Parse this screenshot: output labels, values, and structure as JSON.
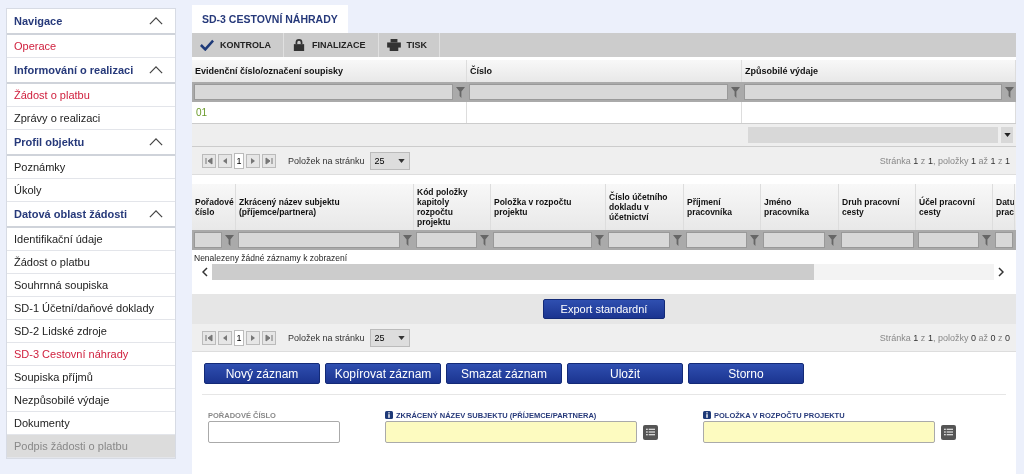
{
  "sidebar": {
    "sections": [
      {
        "title": "Navigace",
        "expanded": true,
        "items": [
          {
            "label": "Operace",
            "selected": true,
            "disabled": false
          }
        ]
      },
      {
        "title": "Informování o realizaci",
        "expanded": true,
        "items": [
          {
            "label": "Žádost o platbu",
            "selected": true,
            "disabled": false
          },
          {
            "label": "Zprávy o realizaci",
            "selected": false,
            "disabled": false
          }
        ]
      },
      {
        "title": "Profil objektu",
        "expanded": true,
        "items": [
          {
            "label": "Poznámky",
            "selected": false,
            "disabled": false
          },
          {
            "label": "Úkoly",
            "selected": false,
            "disabled": false
          }
        ]
      },
      {
        "title": "Datová oblast žádosti",
        "expanded": true,
        "items": [
          {
            "label": "Identifikační údaje",
            "selected": false,
            "disabled": false
          },
          {
            "label": "Žádost o platbu",
            "selected": false,
            "disabled": false
          },
          {
            "label": "Souhrnná soupiska",
            "selected": false,
            "disabled": false
          },
          {
            "label": "SD-1 Účetní/daňové doklady",
            "selected": false,
            "disabled": false
          },
          {
            "label": "SD-2 Lidské zdroje",
            "selected": false,
            "disabled": false
          },
          {
            "label": "SD-3 Cestovní náhrady",
            "selected": true,
            "disabled": false
          },
          {
            "label": "Soupiska příjmů",
            "selected": false,
            "disabled": false
          },
          {
            "label": "Nezpůsobilé výdaje",
            "selected": false,
            "disabled": false
          },
          {
            "label": "Dokumenty",
            "selected": false,
            "disabled": false
          },
          {
            "label": "Podpis žádosti o platbu",
            "selected": false,
            "disabled": true
          }
        ]
      }
    ]
  },
  "tabs": [
    {
      "label": "SD-3 CESTOVNÍ NÁHRADY",
      "selected": true
    }
  ],
  "toolbar": [
    {
      "label": "KONTROLA",
      "kind": "check"
    },
    {
      "label": "FINALIZACE",
      "kind": "lock"
    },
    {
      "label": "TISK",
      "kind": "print"
    }
  ],
  "summary_table": {
    "columns": [
      {
        "label": "Evidenční číslo/označení soupisky",
        "filter": true
      },
      {
        "label": "Číslo",
        "filter": true
      },
      {
        "label": "Způsobilé výdaje",
        "filter": true
      }
    ],
    "rows": [
      [
        "01",
        "",
        ""
      ]
    ],
    "pager": {
      "page": "1",
      "per_page_label": "Položek na stránku",
      "per_page": "25",
      "status": "Stránka **1** z **1**, položky **1** až **1** z **1**"
    }
  },
  "detail_table": {
    "columns": [
      {
        "label": "Pořadové číslo",
        "filter": true
      },
      {
        "label": "Zkrácený název subjektu (příjemce/partnera)",
        "filter": true
      },
      {
        "label": "Kód položky kapitoly rozpočtu projektu",
        "filter": true
      },
      {
        "label": "Položka v rozpočtu projektu",
        "filter": true
      },
      {
        "label": "Číslo účetního dokladu v účetnictví",
        "filter": true
      },
      {
        "label": "Příjmení pracovníka",
        "filter": true
      },
      {
        "label": "Jméno pracovníka",
        "filter": true
      },
      {
        "label": "Druh pracovní cesty",
        "filter": false
      },
      {
        "label": "Účel pracovní cesty",
        "filter": true
      },
      {
        "label": "Datu prac",
        "filter": false
      }
    ],
    "empty_message": "Nenalezeny žádné záznamy k zobrazení",
    "export_button": "Export standardní",
    "pager": {
      "page": "1",
      "per_page_label": "Položek na stránku",
      "per_page": "25",
      "status": "Stránka **1** z **1**, položky **0** až **0** z **0**"
    }
  },
  "actions": [
    "Nový záznam",
    "Kopírovat záznam",
    "Smazat záznam",
    "Uložit",
    "Storno"
  ],
  "form": {
    "fields": [
      {
        "label": "POŘADOVÉ ČÍSLO",
        "required": false
      },
      {
        "label": "ZKRÁCENÝ NÁZEV SUBJEKTU (PŘÍJEMCE/PARTNERA)",
        "required": true
      },
      {
        "label": "POLOŽKA V ROZPOČTU PROJEKTU",
        "required": true
      }
    ]
  }
}
